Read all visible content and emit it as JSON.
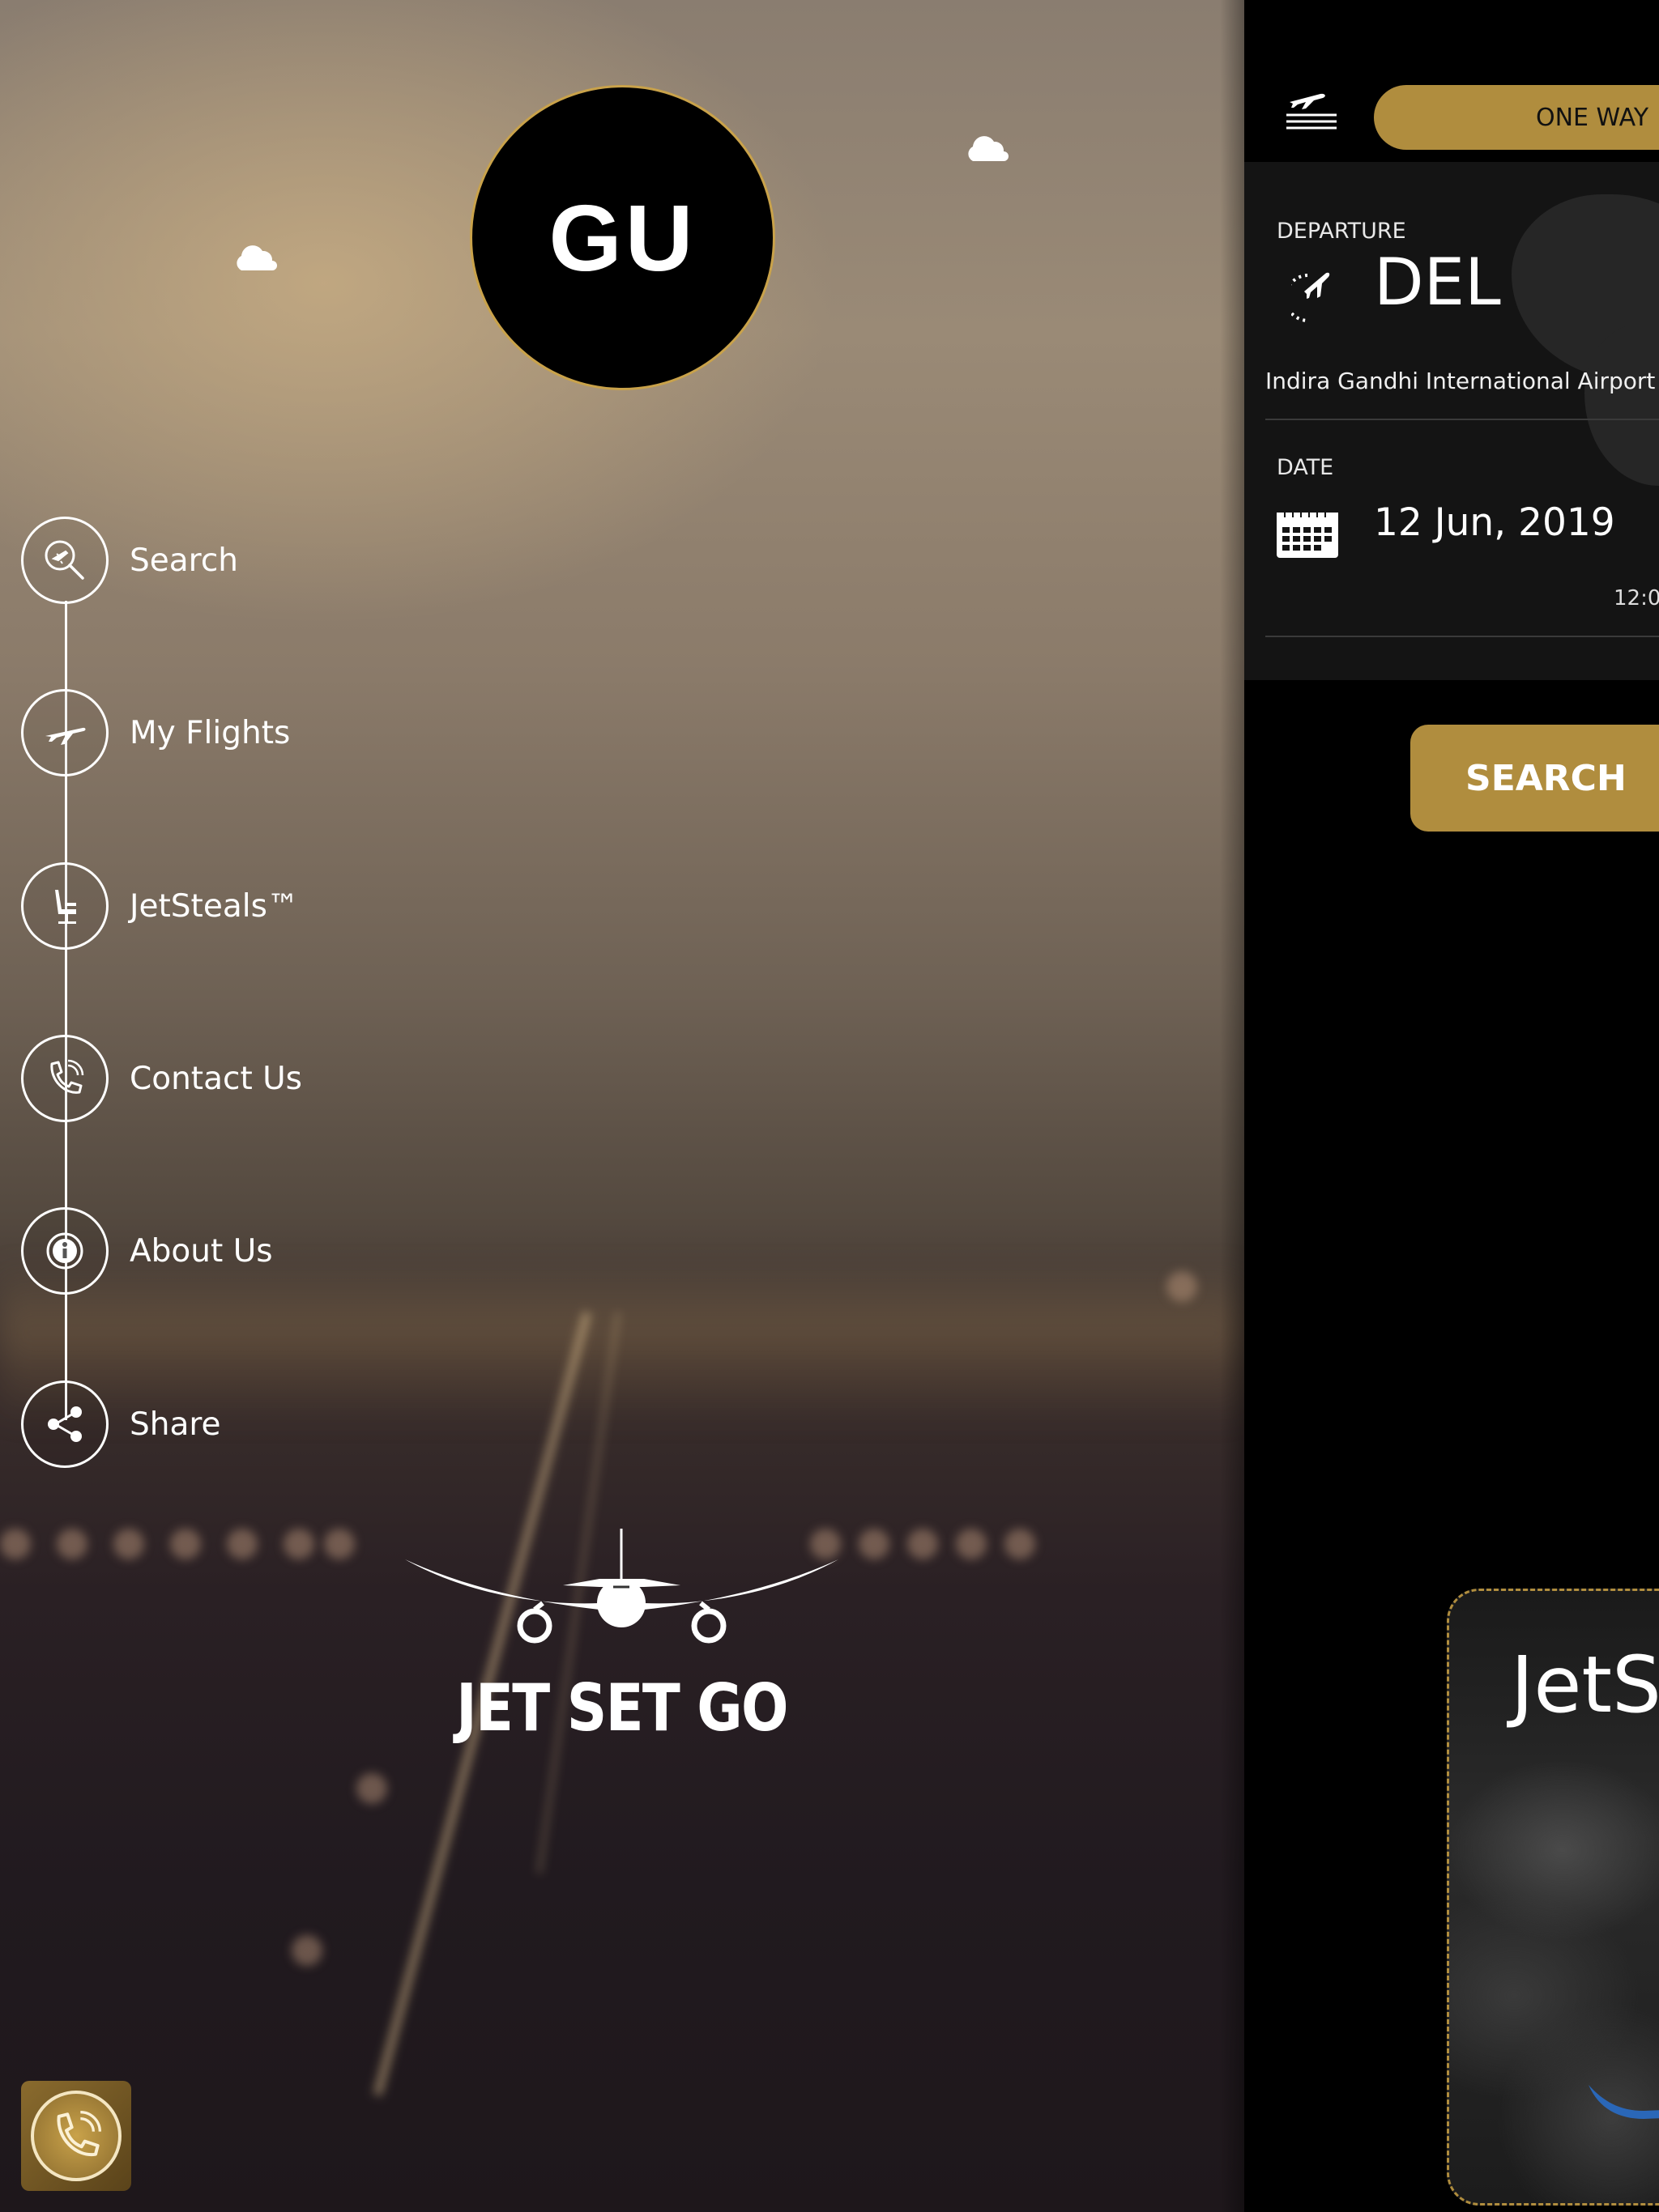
{
  "drawer": {
    "avatar_initials": "GU",
    "menu": [
      {
        "label": "Search",
        "icon": "flight-search-icon"
      },
      {
        "label": "My Flights",
        "icon": "airplane-icon"
      },
      {
        "label": "JetSteals™",
        "icon": "seat-icon"
      },
      {
        "label": "Contact Us",
        "icon": "phone-icon"
      },
      {
        "label": "About Us",
        "icon": "info-icon"
      },
      {
        "label": "Share",
        "icon": "share-icon"
      }
    ],
    "brand": "JET SET GO",
    "call_fab_icon": "phone-call-icon"
  },
  "main": {
    "trip_type": "ONE WAY",
    "departure": {
      "label": "DEPARTURE",
      "code": "DEL",
      "airport": "Indira Gandhi International Airport"
    },
    "date": {
      "label": "DATE",
      "value": "12 Jun, 2019",
      "time": "12:0"
    },
    "search_label": "SEARCH",
    "promo_title": "JetS"
  },
  "colors": {
    "accent_gold": "#b08d3e",
    "avatar_ring": "#c9a24a",
    "background": "#000000"
  }
}
